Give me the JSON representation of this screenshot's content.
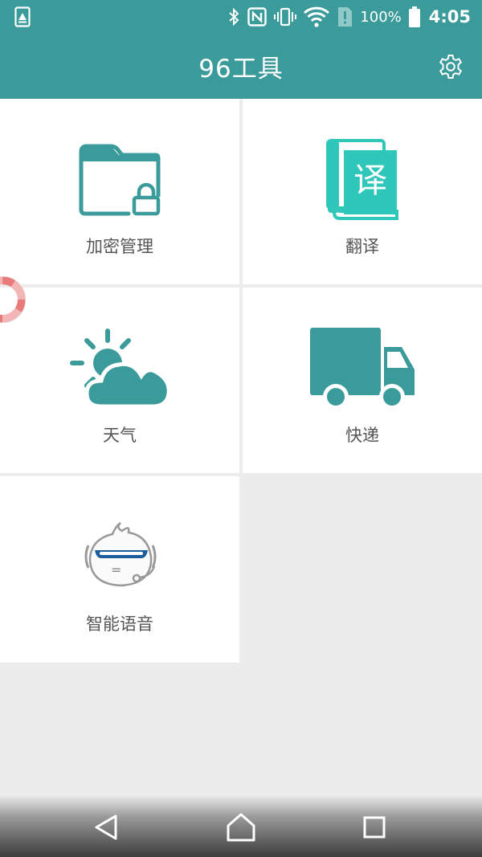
{
  "status_bar": {
    "battery_percent_label": "100%",
    "time": "4:05",
    "icons": [
      "notification-icon",
      "bluetooth-icon",
      "nfc-icon",
      "vibrate-icon",
      "wifi-icon",
      "no-sim-icon",
      "battery-icon"
    ]
  },
  "app_bar": {
    "title": "96工具",
    "settings_icon": "gear-icon"
  },
  "tools": [
    {
      "label": "加密管理",
      "icon": "encrypted-folder-icon"
    },
    {
      "label": "翻译",
      "icon": "translate-book-icon",
      "icon_glyph": "译"
    },
    {
      "label": "天气",
      "icon": "weather-icon"
    },
    {
      "label": "快递",
      "icon": "delivery-truck-icon"
    },
    {
      "label": "智能语音",
      "icon": "voice-assistant-icon",
      "icon_glyph": "="
    }
  ],
  "floating_ball": {
    "icon": "lifebuoy-icon"
  },
  "nav_bar": {
    "buttons": [
      {
        "name": "back",
        "icon": "back-triangle-icon"
      },
      {
        "name": "home",
        "icon": "home-icon"
      },
      {
        "name": "recents",
        "icon": "recents-square-icon"
      }
    ]
  },
  "colors": {
    "brand": "#3a9b9a",
    "translate_accent": "#2ec7b9",
    "background": "#ececec",
    "tile": "#ffffff",
    "label_text": "#555555",
    "voice_visor": "#1a5e9c"
  }
}
